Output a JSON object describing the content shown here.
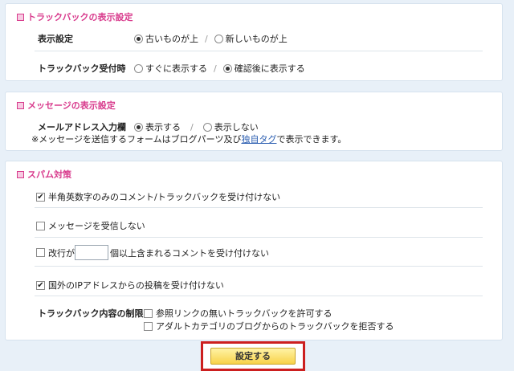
{
  "trackback_display": {
    "title": "トラックバックの表示設定",
    "order_label": "表示設定",
    "order_options": [
      {
        "label": "古いものが上",
        "checked": true
      },
      {
        "label": "新しいものが上",
        "checked": false
      }
    ],
    "receive_label": "トラックバック受付時",
    "receive_options": [
      {
        "label": "すぐに表示する",
        "checked": false
      },
      {
        "label": "確認後に表示する",
        "checked": true
      }
    ],
    "separator": "/"
  },
  "message_display": {
    "title": "メッセージの表示設定",
    "email_label": "メールアドレス入力欄",
    "email_options": [
      {
        "label": "表示する",
        "checked": true
      },
      {
        "label": "表示しない",
        "checked": false
      }
    ],
    "separator": "/",
    "note_before": "※メッセージを送信するフォームはブログパーツ及び",
    "note_link": "独自タグ",
    "note_after": "で表示できます。"
  },
  "spam": {
    "title": "スパム対策",
    "halfwidth_only": {
      "label": "半角英数字のみのコメント/トラックバックを受け付けない",
      "checked": true
    },
    "no_messages": {
      "label": "メッセージを受信しない",
      "checked": false
    },
    "linebreak_before": "改行が",
    "linebreak_value": "",
    "linebreak_after": "個以上含まれるコメントを受け付けない",
    "linebreak_checked": false,
    "foreign_ip": {
      "label": "国外のIPアドレスからの投稿を受け付けない",
      "checked": true
    },
    "trackback_limit_label": "トラックバック内容の制限",
    "trackback_limits": [
      {
        "label": "参照リンクの無いトラックバックを許可する",
        "checked": false
      },
      {
        "label": "アダルトカテゴリのブログからのトラックバックを拒否する",
        "checked": false
      }
    ]
  },
  "submit_label": "設定する",
  "colors": {
    "accent": "#d83a8c",
    "link": "#2a5db0",
    "highlight_border": "#cc1f1f",
    "button": "#f8d24a"
  }
}
